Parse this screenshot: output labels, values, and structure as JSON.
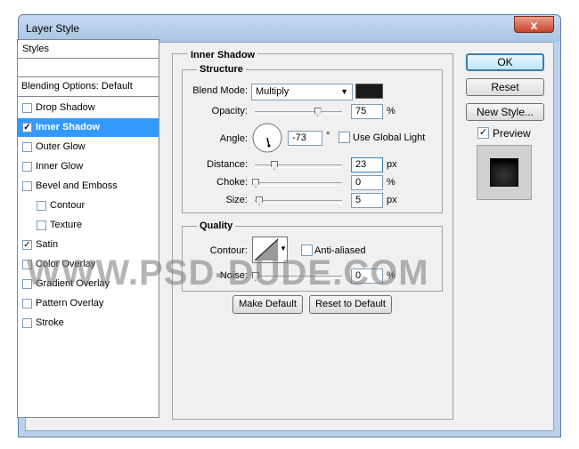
{
  "window": {
    "title": "Layer Style",
    "close_glyph": "x"
  },
  "styles_list": {
    "header": "Styles",
    "blending": "Blending Options: Default",
    "items": [
      {
        "label": "Drop Shadow",
        "checked": false,
        "indent": false,
        "selected": false
      },
      {
        "label": "Inner Shadow",
        "checked": true,
        "indent": false,
        "selected": true
      },
      {
        "label": "Outer Glow",
        "checked": false,
        "indent": false,
        "selected": false
      },
      {
        "label": "Inner Glow",
        "checked": false,
        "indent": false,
        "selected": false
      },
      {
        "label": "Bevel and Emboss",
        "checked": false,
        "indent": false,
        "selected": false
      },
      {
        "label": "Contour",
        "checked": false,
        "indent": true,
        "selected": false
      },
      {
        "label": "Texture",
        "checked": false,
        "indent": true,
        "selected": false
      },
      {
        "label": "Satin",
        "checked": true,
        "indent": false,
        "selected": false
      },
      {
        "label": "Color Overlay",
        "checked": false,
        "indent": false,
        "selected": false
      },
      {
        "label": "Gradient Overlay",
        "checked": false,
        "indent": false,
        "selected": false
      },
      {
        "label": "Pattern Overlay",
        "checked": false,
        "indent": false,
        "selected": false
      },
      {
        "label": "Stroke",
        "checked": false,
        "indent": false,
        "selected": false
      }
    ]
  },
  "inner_shadow": {
    "section_title": "Inner Shadow",
    "structure": {
      "title": "Structure",
      "blend_mode_label": "Blend Mode:",
      "blend_mode_value": "Multiply",
      "blend_color": "#1a1a1a",
      "opacity_label": "Opacity:",
      "opacity_value": "75",
      "opacity_unit": "%",
      "opacity_level": 0.75,
      "angle_label": "Angle:",
      "angle_value": "-73",
      "angle_unit": "°",
      "global_light_label": "Use Global Light",
      "distance_label": "Distance:",
      "distance_value": "23",
      "distance_unit": "px",
      "choke_label": "Choke:",
      "choke_value": "0",
      "choke_unit": "%",
      "size_label": "Size:",
      "size_value": "5",
      "size_unit": "px"
    },
    "quality": {
      "title": "Quality",
      "contour_label": "Contour:",
      "anti_aliased_label": "Anti-aliased",
      "noise_label": "Noise:",
      "noise_value": "0",
      "noise_unit": "%"
    },
    "make_default": "Make Default",
    "reset_default": "Reset to Default"
  },
  "actions": {
    "ok": "OK",
    "reset": "Reset",
    "new_style": "New Style...",
    "preview_label": "Preview",
    "preview_checked": true
  },
  "watermark": "WWW.PSD-DUDE.COM"
}
